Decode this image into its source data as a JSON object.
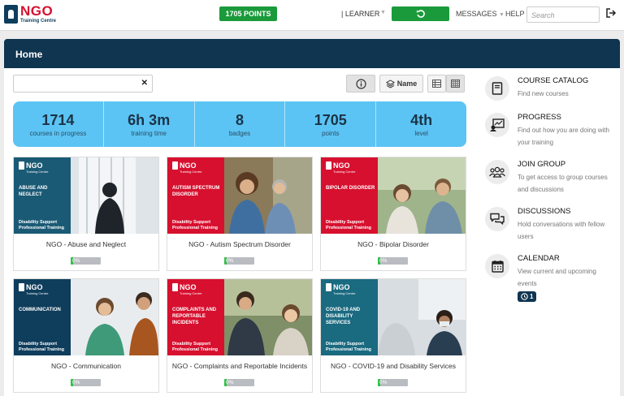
{
  "brand": {
    "name": "NGO",
    "sub": "Training Centre",
    "color": "#d7102f"
  },
  "topbar": {
    "points": "1705 POINTS",
    "role": "| LEARNER",
    "messages": "MESSAGES",
    "help": "HELP",
    "search_placeholder": "Search"
  },
  "page": {
    "title": "Home"
  },
  "toolbar": {
    "sort_label": "Name"
  },
  "stats": [
    {
      "value": "1714",
      "label": "courses in progress"
    },
    {
      "value": "6h 3m",
      "label": "training time"
    },
    {
      "value": "8",
      "label": "badges"
    },
    {
      "value": "1705",
      "label": "points"
    },
    {
      "value": "4th",
      "label": "level"
    }
  ],
  "card_footer": "Disability Support Professional Training",
  "courses": [
    {
      "title": "NGO - Abuse and Neglect",
      "category": "ABUSE AND NEGLECT",
      "progress": "0%",
      "color": "#1a5a75"
    },
    {
      "title": "NGO - Autism Spectrum Disorder",
      "category": "AUTISM SPECTRUM DISORDER",
      "progress": "0%",
      "color": "#d7102f"
    },
    {
      "title": "NGO - Bipolar Disorder",
      "category": "BIPOLAR DISORDER",
      "progress": "0%",
      "color": "#d7102f"
    },
    {
      "title": "NGO - Communication",
      "category": "COMMUNICATION",
      "progress": "0%",
      "color": "#0f3d5c"
    },
    {
      "title": "NGO - Complaints and Reportable Incidents",
      "category": "COMPLAINTS AND REPORTABLE INCIDENTS",
      "progress": "0%",
      "color": "#d7102f"
    },
    {
      "title": "NGO - COVID-19 and Disability Services",
      "category": "COVID-19 AND DISABILITY SERVICES",
      "progress": "0%",
      "color": "#1a6a80"
    }
  ],
  "sidebar": [
    {
      "title": "COURSE CATALOG",
      "desc": "Find new courses",
      "icon": "book-icon"
    },
    {
      "title": "PROGRESS",
      "desc": "Find out how you are doing with your training",
      "icon": "progress-chart-icon"
    },
    {
      "title": "JOIN GROUP",
      "desc": "To get access to group courses and discussions",
      "icon": "group-icon"
    },
    {
      "title": "DISCUSSIONS",
      "desc": "Hold conversations with fellow users",
      "icon": "chat-icon"
    },
    {
      "title": "CALENDAR",
      "desc": "View current and upcoming events",
      "icon": "calendar-icon",
      "badge": "1"
    }
  ]
}
